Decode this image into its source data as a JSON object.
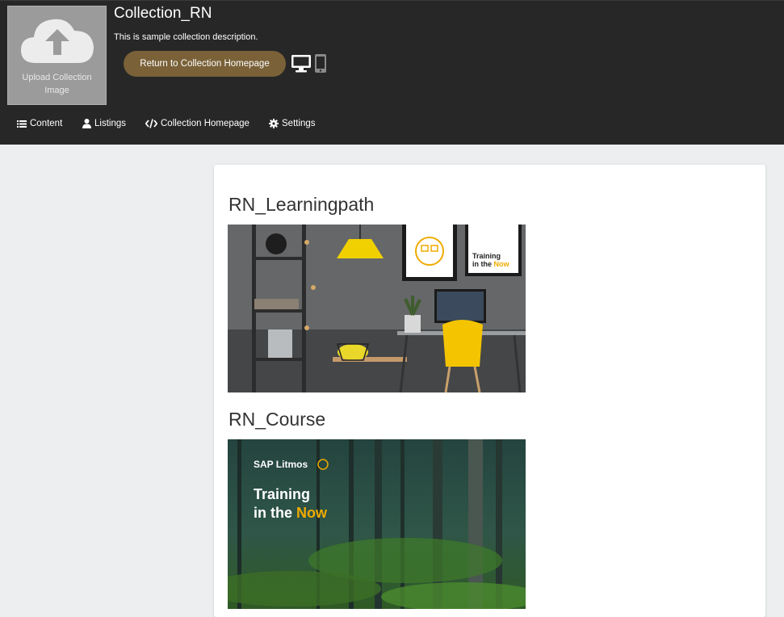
{
  "header": {
    "upload_label": "Upload Collection Image",
    "title": "Collection_RN",
    "description": "This is sample collection description.",
    "return_button": "Return to Collection Homepage",
    "icons": {
      "upload": "cloud-upload-icon",
      "desktop": "desktop-icon",
      "mobile": "mobile-icon"
    }
  },
  "nav": [
    {
      "label": "Content",
      "icon": "list-icon"
    },
    {
      "label": "Listings",
      "icon": "user-icon"
    },
    {
      "label": "Collection Homepage",
      "icon": "code-icon"
    },
    {
      "label": "Settings",
      "icon": "gear-icon"
    }
  ],
  "items": [
    {
      "title": "RN_Learningpath",
      "image": {
        "text_line1": "Training",
        "text_line2_a": "in the ",
        "text_line2_b": "Now"
      }
    },
    {
      "title": "RN_Course",
      "image": {
        "brand": "SAP Litmos",
        "text_line1": "Training",
        "text_line2_a": "in the ",
        "text_line2_b": "Now"
      }
    }
  ],
  "colors": {
    "header_bg": "#272727",
    "accent_button": "#7a6138",
    "page_bg": "#eceeef",
    "highlight_yellow": "#f0ab00"
  }
}
